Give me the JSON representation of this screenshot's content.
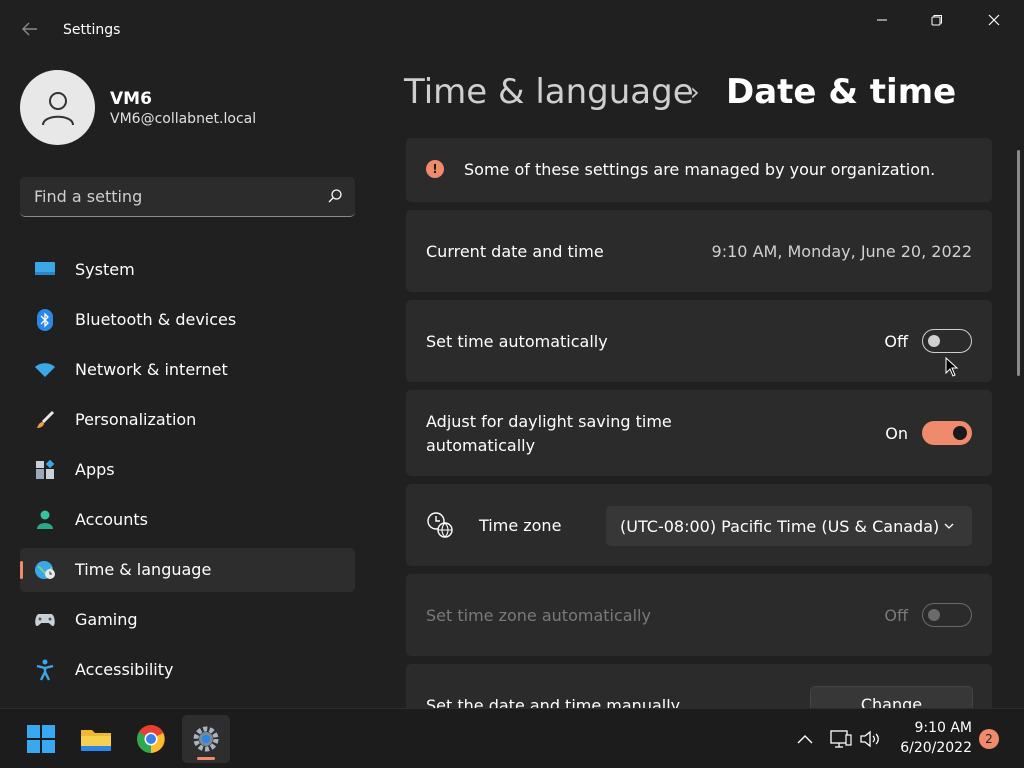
{
  "window": {
    "title": "Settings"
  },
  "profile": {
    "name": "VM6",
    "email": "VM6@collabnet.local"
  },
  "search": {
    "placeholder": "Find a setting",
    "value": ""
  },
  "sidebar": {
    "items": [
      {
        "label": "System",
        "icon": "monitor-icon"
      },
      {
        "label": "Bluetooth & devices",
        "icon": "bluetooth-icon"
      },
      {
        "label": "Network & internet",
        "icon": "wifi-icon"
      },
      {
        "label": "Personalization",
        "icon": "paintbrush-icon"
      },
      {
        "label": "Apps",
        "icon": "apps-icon"
      },
      {
        "label": "Accounts",
        "icon": "person-icon"
      },
      {
        "label": "Time & language",
        "icon": "globe-clock-icon",
        "active": true
      },
      {
        "label": "Gaming",
        "icon": "gamepad-icon"
      },
      {
        "label": "Accessibility",
        "icon": "accessibility-icon"
      }
    ]
  },
  "header": {
    "parent": "Time & language",
    "separator": "›",
    "current": "Date & time"
  },
  "banner": {
    "text": "Some of these settings are managed by your organization.",
    "icon": "info-icon"
  },
  "settings": {
    "current_datetime": {
      "label": "Current date and time",
      "value": "9:10 AM, Monday, June 20, 2022"
    },
    "set_time_auto": {
      "label": "Set time automatically",
      "state": "Off"
    },
    "daylight_saving": {
      "label_line1": "Adjust for daylight saving time",
      "label_line2": "automatically",
      "state": "On"
    },
    "time_zone": {
      "label": "Time zone",
      "value": "(UTC-08:00) Pacific Time (US & Canada)"
    },
    "set_tz_auto": {
      "label": "Set time zone automatically",
      "state": "Off"
    },
    "manual": {
      "label": "Set the date and time manually",
      "button": "Change"
    }
  },
  "taskbar": {
    "apps": [
      "start-icon",
      "file-explorer-icon",
      "chrome-icon",
      "settings-icon"
    ],
    "clock_time": "9:10 AM",
    "clock_date": "6/20/2022",
    "notification_count": "2"
  },
  "colors": {
    "accent": "#f08a6c",
    "background": "#202020",
    "card": "#2b2b2b"
  }
}
